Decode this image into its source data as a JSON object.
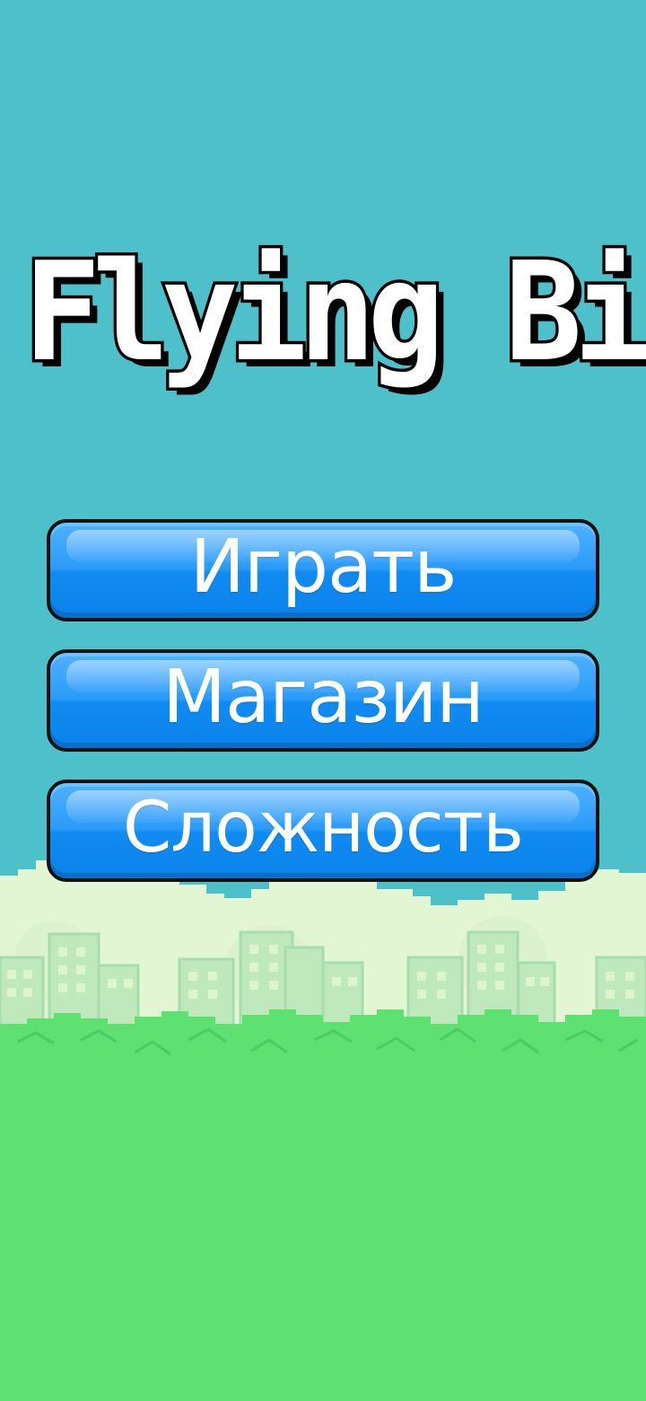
{
  "game": {
    "title": "Flying Bird",
    "menu": {
      "play_label": "Играть",
      "shop_label": "Магазин",
      "difficulty_label": "Сложность"
    }
  },
  "colors": {
    "sky": "#4ec0ca",
    "cloud": "#e2f6d4",
    "building": "#b7e9b3",
    "window": "#d6f2c4",
    "bush": "#5ee171",
    "bush_dark": "#4dca63",
    "button": "#1a90f2",
    "button_text": "#ffffff"
  }
}
